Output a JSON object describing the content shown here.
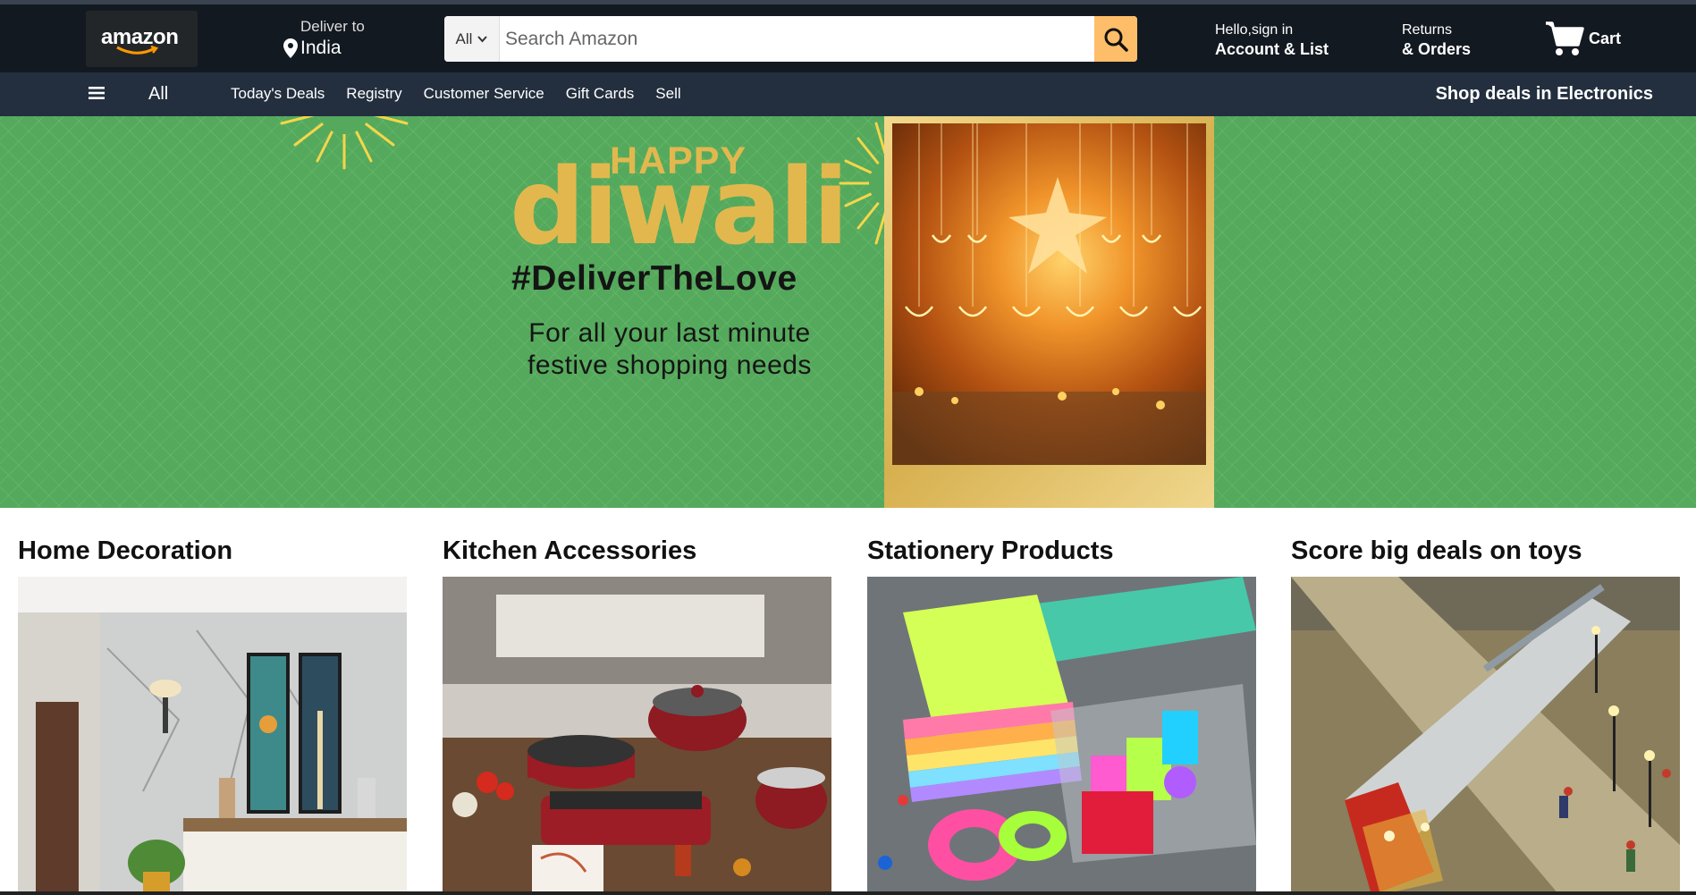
{
  "header": {
    "logo_text": "amazon",
    "deliver_small": "Deliver to",
    "deliver_location": "India",
    "search": {
      "category": "All",
      "placeholder": "Search Amazon"
    },
    "account_small": "Hello,sign in",
    "account_big": "Account & List",
    "returns_small": "Returns",
    "returns_big": "& Orders",
    "cart_label": "Cart"
  },
  "subnav": {
    "all_label": "All",
    "links": [
      "Today's Deals",
      "Registry",
      "Customer Service",
      "Gift Cards",
      "Sell"
    ],
    "promo": "Shop deals in Electronics"
  },
  "hero": {
    "happy": "HAPPY",
    "diwali": "diwali",
    "hashtag": "#DeliverTheLove",
    "subtitle": "For all your last minute festive shopping needs"
  },
  "cards": [
    {
      "title": "Home Decoration"
    },
    {
      "title": "Kitchen Accessories"
    },
    {
      "title": "Stationery Products"
    },
    {
      "title": "Score big deals on toys"
    }
  ],
  "colors": {
    "nav_dark": "#131921",
    "nav_secondary": "#232f3e",
    "search_button": "#febd69",
    "hero_green": "#55a95c",
    "gold": "#e2b84e"
  }
}
